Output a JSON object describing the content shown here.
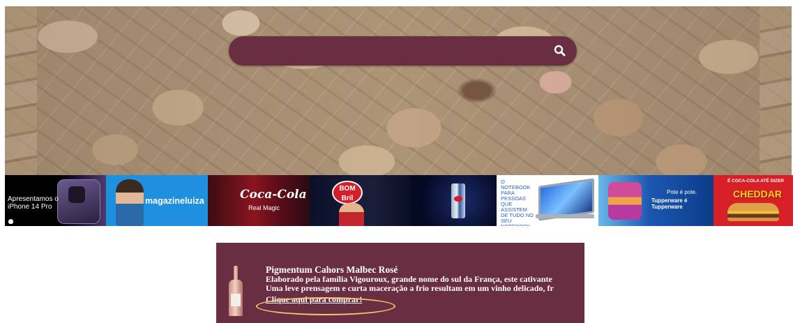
{
  "search": {
    "placeholder": "",
    "icon": "search-icon"
  },
  "ads": {
    "apple": {
      "line1": "Apresentamos o",
      "line2": "iPhone 14 Pro"
    },
    "magalu": {
      "brand": "magazineluiza"
    },
    "coke": {
      "logo": "Coca-Cola",
      "tagline": "Real Magic"
    },
    "bombril": {
      "logo_line1": "BOM",
      "logo_line2": "Bril"
    },
    "notebook": {
      "text": "O NOTEBOOK PARA PESSOAS QUE ASSISTEM DE TUDO NO SEU NOTEBOOK."
    },
    "tupperware": {
      "line1": "Pote é pote.",
      "line2": "Tupperware é Tupperware"
    },
    "mcdonalds": {
      "headline": "É COCA-COLA ATÉ DIZER",
      "product": "CHEDDAR"
    }
  },
  "product": {
    "title": "Pigmentum Cahors Malbec Rosé",
    "description_line1": "Elaborado pela família Vigouroux, grande nome do sul da França, este cativante",
    "description_line2": "Uma leve prensagem e curta maceração a frio resultam em um vinho delicado, fr",
    "buy_link": "Clique aqui para comprar!"
  },
  "colors": {
    "brand_wine": "#6a2e42",
    "highlight": "#f2c86a"
  }
}
